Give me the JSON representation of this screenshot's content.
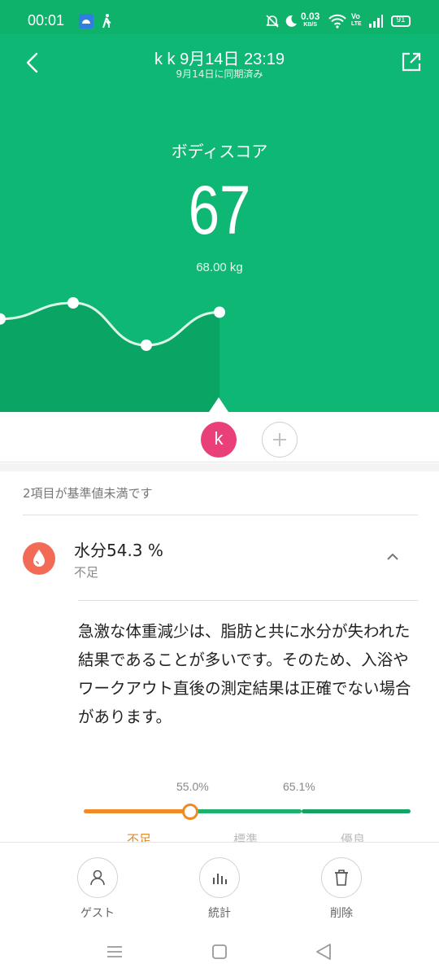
{
  "status_bar": {
    "time": "00:01",
    "net_speed_value": "0.03",
    "net_speed_unit": "KB/S",
    "volte_top": "Vo",
    "volte_bottom": "LTE",
    "battery": "91",
    "icons": [
      "android-debug-icon",
      "walking-icon",
      "mute-bell-icon",
      "moon-icon",
      "wifi-icon",
      "signal-icon",
      "battery-icon"
    ]
  },
  "header": {
    "title": "k k 9月14日 23:19",
    "subtitle": "9月14日に同期済み",
    "score_label": "ボディスコア",
    "score_value": "67",
    "weight": "68.00 kg"
  },
  "trend_chart": {
    "points": [
      0.62,
      1.0,
      0.0,
      0.78
    ],
    "fill_color": "#0aa565",
    "line_color": "#d9f6e6"
  },
  "user_row": {
    "avatar_letter": "k",
    "avatar_color": "#e9407a"
  },
  "summary": {
    "notice": "2項目が基準値未満です"
  },
  "metric": {
    "title": "水分54.3 %",
    "status": "不足",
    "description": "急激な体重減少は、脂肪と共に水分が失われた結果であることが多いです。そのため、入浴やワークアウト直後の測定結果は正確でない場合があります。",
    "threshold_low": "55.0%",
    "threshold_high": "65.1%",
    "range_labels": [
      "不足",
      "標準",
      "優良"
    ],
    "level_fraction": 0.325,
    "colors": {
      "low": "#ef8a25",
      "standard": "#1db26b",
      "excellent": "#14a362",
      "icon": "#f26b56"
    }
  },
  "actions": [
    {
      "label": "ゲスト",
      "icon": "person-icon"
    },
    {
      "label": "統計",
      "icon": "bar-chart-icon"
    },
    {
      "label": "削除",
      "icon": "trash-icon"
    }
  ],
  "nav": [
    "menu-icon",
    "home-icon",
    "back-icon"
  ]
}
